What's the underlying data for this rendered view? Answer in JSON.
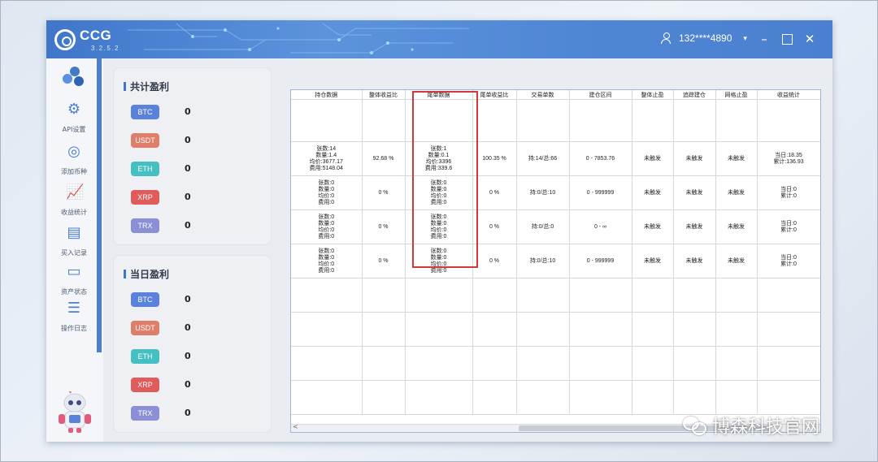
{
  "app": {
    "name": "CCG",
    "version": "3.2.5.2",
    "user": "132****4890"
  },
  "colors": {
    "titlebar": "#4a80cf",
    "btc": "#5b82db",
    "usdt": "#e07e6c",
    "eth": "#45c0c2",
    "xrp": "#e05c5c",
    "trx": "#8a8fd6",
    "highlight": "#d23a3a"
  },
  "sidebar": {
    "items": [
      {
        "label": "API设置",
        "icon": "gear-icon"
      },
      {
        "label": "添加币种",
        "icon": "add-coin-icon"
      },
      {
        "label": "收益统计",
        "icon": "chart-icon"
      },
      {
        "label": "买入记录",
        "icon": "record-icon"
      },
      {
        "label": "资产状态",
        "icon": "wallet-icon"
      },
      {
        "label": "操作日志",
        "icon": "log-icon"
      }
    ]
  },
  "total_profit": {
    "title": "共计盈利",
    "coins": [
      {
        "name": "BTC",
        "value": "0"
      },
      {
        "name": "USDT",
        "value": "0"
      },
      {
        "name": "ETH",
        "value": "0"
      },
      {
        "name": "XRP",
        "value": "0"
      },
      {
        "name": "TRX",
        "value": "0"
      }
    ]
  },
  "daily_profit": {
    "title": "当日盈利",
    "coins": [
      {
        "name": "BTC",
        "value": "0"
      },
      {
        "name": "USDT",
        "value": "0"
      },
      {
        "name": "ETH",
        "value": "0"
      },
      {
        "name": "XRP",
        "value": "0"
      },
      {
        "name": "TRX",
        "value": "0"
      }
    ]
  },
  "table": {
    "headers": [
      "持仓数据",
      "整体收益比",
      "尾单数据",
      "尾单收益比",
      "交易单数",
      "建仓区间",
      "整体止盈",
      "追踪建仓",
      "网格止盈",
      "收益统计"
    ],
    "rows": [
      [
        "",
        "",
        "",
        "",
        "",
        "",
        "",
        "",
        "",
        ""
      ],
      [
        "张数:14\n数量:1.4\n均价:3677.17\n费用:5148.04",
        "92.68 %",
        "张数:1\n数量:0.1\n均价:3396\n费用:339.6",
        "100.35 %",
        "持:14/总:66",
        "0 - 7853.76",
        "未触发",
        "未触发",
        "未触发",
        "当日:18.35\n累计:136.93"
      ],
      [
        "张数:0\n数量:0\n均价:0\n费用:0",
        "0 %",
        "张数:0\n数量:0\n均价:0\n费用:0",
        "0 %",
        "持:0/总:10",
        "0 - 999999",
        "未触发",
        "未触发",
        "未触发",
        "当日:0\n累计:0"
      ],
      [
        "张数:0\n数量:0\n均价:0\n费用:0",
        "0 %",
        "张数:0\n数量:0\n均价:0\n费用:0",
        "0 %",
        "持:0/总:0",
        "0 - ∞",
        "未触发",
        "未触发",
        "未触发",
        "当日:0\n累计:0"
      ],
      [
        "张数:0\n数量:0\n均价:0\n费用:0",
        "0 %",
        "张数:0\n数量:0\n均价:0\n费用:0",
        "0 %",
        "持:0/总:10",
        "0 - 999999",
        "未触发",
        "未触发",
        "未触发",
        "当日:0\n累计:0"
      ],
      [
        "",
        "",
        "",
        "",
        "",
        "",
        "",
        "",
        "",
        ""
      ],
      [
        "",
        "",
        "",
        "",
        "",
        "",
        "",
        "",
        "",
        ""
      ],
      [
        "",
        "",
        "",
        "",
        "",
        "",
        "",
        "",
        "",
        ""
      ],
      [
        "",
        "",
        "",
        "",
        "",
        "",
        "",
        "",
        "",
        ""
      ]
    ]
  },
  "watermark": "博森科技官网"
}
